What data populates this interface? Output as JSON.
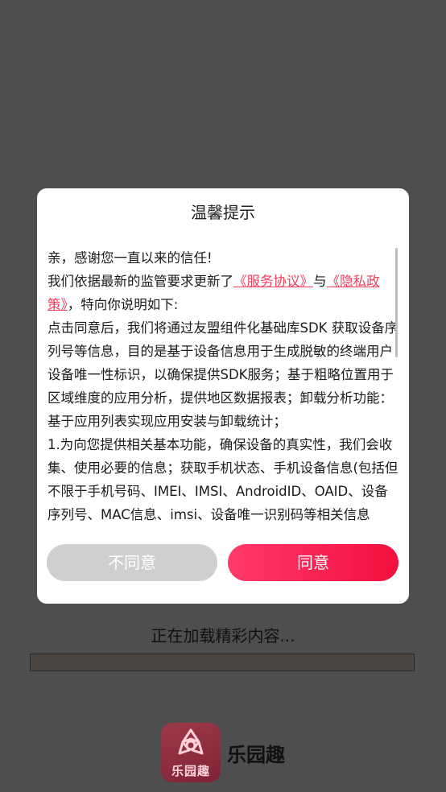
{
  "loading": {
    "text": "正在加载精彩内容...",
    "progress": 0.0
  },
  "brand": {
    "icon_text": "乐园趣",
    "name": "乐园趣"
  },
  "dialog": {
    "title": "温馨提示",
    "intro": "亲，感谢您一直以来的信任!",
    "update_prefix": "我们依据最新的监管要求更新了",
    "service_link": "《服务协议》",
    "and_text": "与",
    "privacy_link": "《隐私政策》",
    "update_suffix": "，特向你说明如下:",
    "para_1": "点击同意后，我们将通过友盟组件化基础库SDK 获取设备序列号等信息，目的是基于设备信息用于生成脱敏的终端用户设备唯一性标识，以确保提供SDK服务；基于粗略位置用于区域维度的应用分析，提供地区数据报表；卸载分析功能：基于应用列表实现应用安装与卸载统计；",
    "para_2": "1.为向您提供相关基本功能，确保设备的真实性，我们会收集、使用必要的信息；获取手机状态、手机设备信息(包括但不限于手机号码、IMEI、IMSI、AndroidID、OAID、设备序列号、MAC信息、imsi、设备唯一识别码等相关信息",
    "disagree_label": "不同意",
    "agree_label": "同意"
  }
}
